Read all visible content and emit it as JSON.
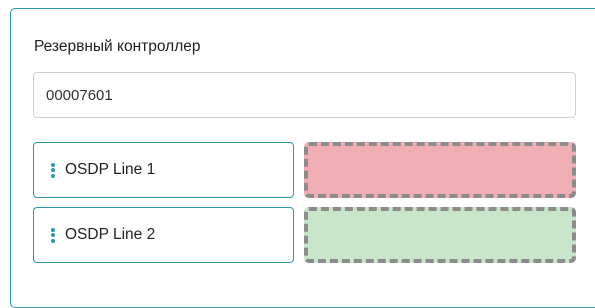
{
  "reserve_controller": {
    "label": "Резервный контроллер",
    "value": "00007601"
  },
  "lines": [
    {
      "label": "OSDP Line 1",
      "handle_icon": "vertical-dots-drag-icon"
    },
    {
      "label": "OSDP Line 2",
      "handle_icon": "vertical-dots-drag-icon"
    }
  ],
  "drop_zones": [
    {
      "state": "error",
      "color": "#f0adb3"
    },
    {
      "state": "success",
      "color": "#c8e6c9"
    }
  ],
  "colors": {
    "accent": "#2e98a6",
    "dash_border": "#8c8c8c"
  }
}
